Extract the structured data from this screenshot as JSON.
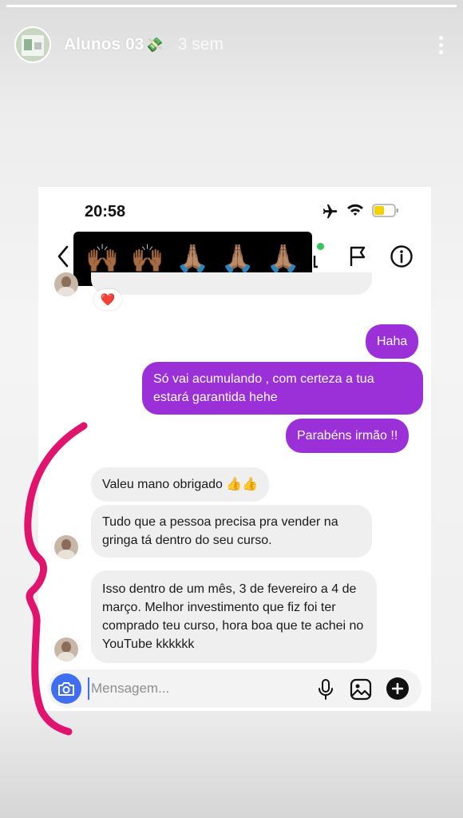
{
  "story": {
    "progress": 1.0,
    "account_name": "Alunos 03",
    "account_emoji": "💸",
    "time_ago": "3 sem",
    "more_icon": "more-vertical-icon"
  },
  "screenshot": {
    "status_bar": {
      "time": "20:58",
      "icons": [
        "airplane-icon",
        "wifi-icon",
        "battery-icon"
      ],
      "battery_color": "#f5d000"
    },
    "chat_header": {
      "cover_emojis": [
        "🙌🏾",
        "🙌🏾",
        "🙏🏽",
        "🙏🏽",
        "🙏🏽"
      ],
      "icons": [
        "back-icon",
        "flag-icon",
        "info-icon"
      ]
    },
    "reaction": "❤️",
    "messages": [
      {
        "direction": "out",
        "text": "Haha"
      },
      {
        "direction": "out",
        "text": "Só vai acumulando , com certeza a tua estará garantida hehe"
      },
      {
        "direction": "out",
        "text": "Parabéns irmão !!"
      },
      {
        "direction": "in",
        "text": "Valeu mano obrigado 👍👍"
      },
      {
        "direction": "in",
        "text": "Tudo que a pessoa precisa pra  vender na gringa tá dentro do seu curso."
      },
      {
        "direction": "in",
        "text": "Isso dentro de um mês, 3 de fevereiro a 4 de março. Melhor investimento que fiz foi ter comprado teu curso, hora boa que te achei no YouTube kkkkkk"
      }
    ],
    "composer": {
      "placeholder": "Mensagem...",
      "value": "",
      "icons": [
        "camera-icon",
        "mic-icon",
        "gallery-icon",
        "plus-icon"
      ]
    }
  },
  "colors": {
    "outgoing_bubble": "#9b30d9",
    "incoming_bubble": "#efefef",
    "camera_button": "#3f6ff0",
    "annotation_stroke": "#e0136f"
  }
}
